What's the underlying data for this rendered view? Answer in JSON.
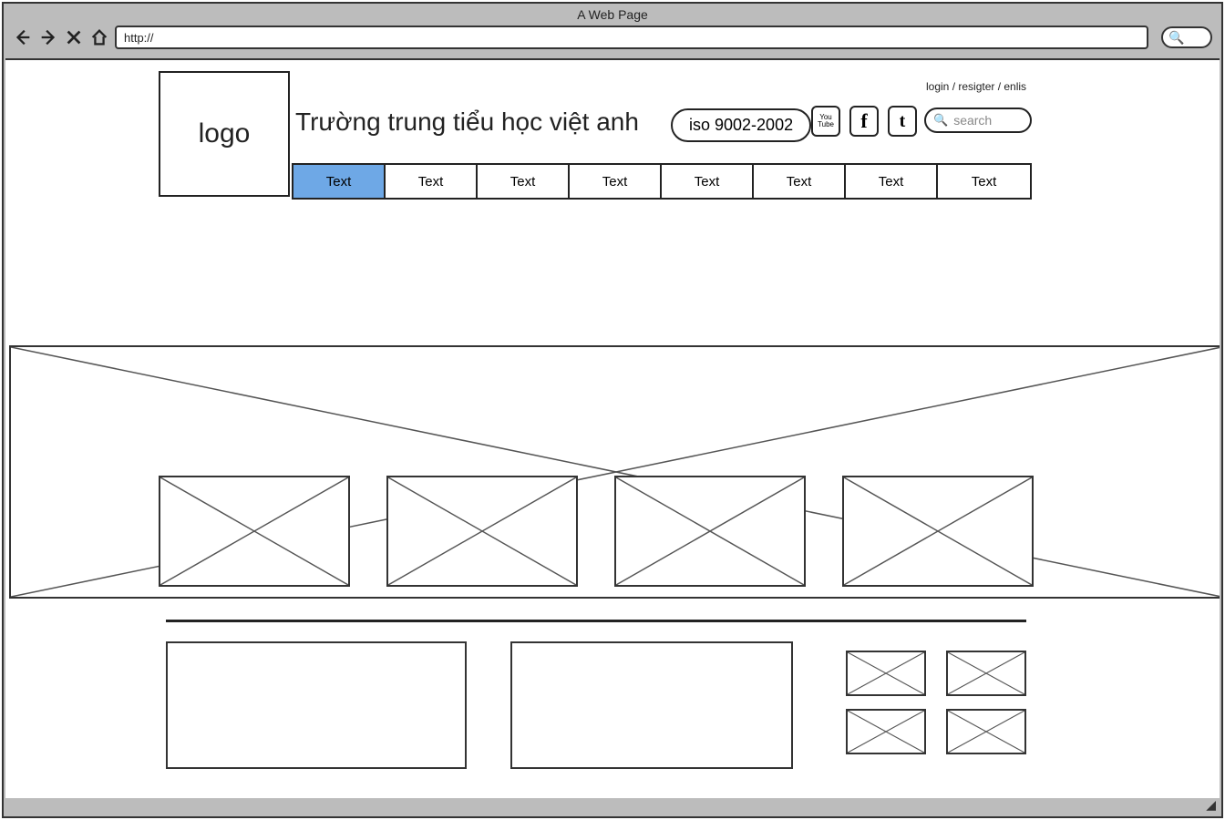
{
  "browser": {
    "title": "A Web Page",
    "url": "http://",
    "search_icon": "🔍"
  },
  "header": {
    "logo_text": "logo",
    "site_title": "Trường trung tiểu học việt anh",
    "iso_badge": "iso 9002-2002",
    "social": {
      "youtube": "You\nTube",
      "facebook": "f",
      "twitter": "t"
    },
    "top_links": "login / resigter / enlis",
    "search_placeholder": "search"
  },
  "nav": {
    "tabs": [
      {
        "label": "Text",
        "active": true
      },
      {
        "label": "Text",
        "active": false
      },
      {
        "label": "Text",
        "active": false
      },
      {
        "label": "Text",
        "active": false
      },
      {
        "label": "Text",
        "active": false
      },
      {
        "label": "Text",
        "active": false
      },
      {
        "label": "Text",
        "active": false
      },
      {
        "label": "Text",
        "active": false
      }
    ]
  }
}
